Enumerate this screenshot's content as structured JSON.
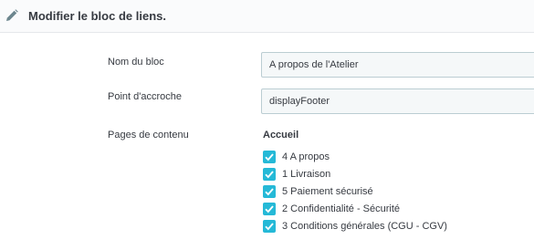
{
  "panel": {
    "title": "Modifier le bloc de liens.",
    "icon": "pencil-icon"
  },
  "form": {
    "block_name": {
      "label": "Nom du bloc",
      "value": "A propos de l'Atelier"
    },
    "hook": {
      "label": "Point d'accroche",
      "value": "displayFooter"
    },
    "content_pages": {
      "label": "Pages de contenu",
      "group_title": "Accueil",
      "items": [
        {
          "label": "4 A propos",
          "checked": true
        },
        {
          "label": "1 Livraison",
          "checked": true
        },
        {
          "label": "5 Paiement sécurisé",
          "checked": true
        },
        {
          "label": "2 Confidentialité - Sécurité",
          "checked": true
        },
        {
          "label": "3 Conditions générales (CGU - CGV)",
          "checked": true
        }
      ]
    }
  },
  "colors": {
    "accent": "#25b9d7",
    "text": "#363a41",
    "input_bg": "#f5f8f9",
    "input_border": "#bbcdd2"
  }
}
